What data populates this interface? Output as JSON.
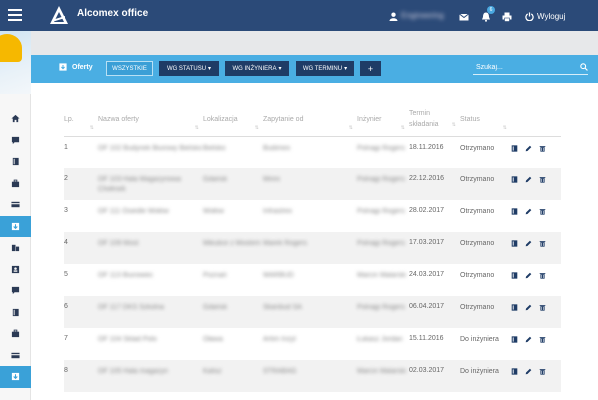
{
  "app": {
    "title": "Alcomex office",
    "user_name": "Engineering",
    "notification_count": "6",
    "logout_label": "Wyloguj"
  },
  "toolbar": {
    "section_label": "Oferty",
    "filters": [
      "WSZYSTKIE",
      "WG STATUSU",
      "WG INŻYNIERA",
      "WG TERMINU"
    ],
    "add_label": "+",
    "search_placeholder": "Szukaj..."
  },
  "table": {
    "headers": [
      "Lp.",
      "Nazwa oferty",
      "Lokalizacja",
      "Zapytanie od",
      "Inżynier",
      "Termin składania",
      "Status"
    ],
    "rows": [
      {
        "lp": "1",
        "name": "OF 102 Budynek Biurowy Bielsko",
        "location": "Bielsko",
        "from": "Budimex",
        "engineer": "Polnajp Rogers",
        "deadline": "18.11.2016",
        "status": "Otrzymano"
      },
      {
        "lp": "2",
        "name": "OF 103 Hala Magazynowa Chełmek",
        "location": "Gdańsk",
        "from": "Mirex",
        "engineer": "Polnajp Rogers",
        "deadline": "22.12.2016",
        "status": "Otrzymano"
      },
      {
        "lp": "3",
        "name": "OF 111 Osiedle Wołów",
        "location": "Wołów",
        "from": "Infrastrex",
        "engineer": "Polnajp Rogers",
        "deadline": "28.02.2017",
        "status": "Otrzymano"
      },
      {
        "lp": "4",
        "name": "OF 109 Most",
        "location": "Mikulice z Mostem",
        "from": "Marek Rogers",
        "engineer": "Polnajp Rogers",
        "deadline": "17.03.2017",
        "status": "Otrzymano"
      },
      {
        "lp": "5",
        "name": "OF 113 Biurowiec",
        "location": "Poznań",
        "from": "WARBUD",
        "engineer": "Marcin Malarski",
        "deadline": "24.03.2017",
        "status": "Otrzymano"
      },
      {
        "lp": "6",
        "name": "OF 117 DKS Szkolna",
        "location": "Gdańsk",
        "from": "Skanbud SA",
        "engineer": "Polnajp Rogers",
        "deadline": "06.04.2017",
        "status": "Otrzymano"
      },
      {
        "lp": "7",
        "name": "OF 104 Sklad Polo",
        "location": "Oława",
        "from": "Artim Inżyl",
        "engineer": "Łukasz Jordan",
        "deadline": "15.11.2016",
        "status": "Do inżyniera"
      },
      {
        "lp": "8",
        "name": "OF 105 Hala magazyn",
        "location": "Kalisz",
        "from": "STRABAG",
        "engineer": "Marcin Malarski",
        "deadline": "02.03.2017",
        "status": "Do inżyniera"
      }
    ]
  },
  "colors": {
    "topbar": "#2b4a78",
    "toolbar": "#4aaee3",
    "active_side": "#3aa1d8",
    "dark_button": "#1f3c66"
  }
}
